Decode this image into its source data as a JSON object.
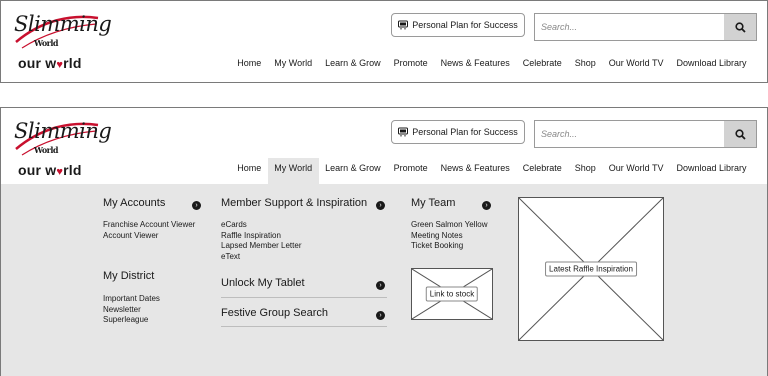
{
  "logo": {
    "script_line1": "Slimming",
    "script_line2": "World",
    "sub_prefix": "our w",
    "sub_suffix": "rld",
    "heart": "♥"
  },
  "header": {
    "plan_button_label": "Personal Plan for Success",
    "search_placeholder": "Search..."
  },
  "nav": [
    "Home",
    "My World",
    "Learn & Grow",
    "Promote",
    "News & Features",
    "Celebrate",
    "Shop",
    "Our World TV",
    "Download Library"
  ],
  "nav_active": "My World",
  "mega_menu": {
    "my_accounts": {
      "title": "My Accounts",
      "links": [
        "Franchise Account Viewer",
        "Account Viewer"
      ]
    },
    "my_district": {
      "title": "My District",
      "links": [
        "Important Dates",
        "Newsletter",
        "Superleague"
      ]
    },
    "member_support": {
      "title": "Member Support & Inspiration",
      "links": [
        "eCards",
        "Raffle Inspiration",
        "Lapsed Member Letter",
        "eText"
      ]
    },
    "unlock_tablet": {
      "title": "Unlock My Tablet"
    },
    "festive_search": {
      "title": "Festive Group Search"
    },
    "my_team": {
      "title": "My Team",
      "links": [
        "Green Salmon Yellow",
        "Meeting Notes",
        "Ticket Booking"
      ]
    },
    "link_to_stock": "Link to stock",
    "latest_raffle": "Latest Raffle Inspiration"
  },
  "colors": {
    "brand_red": "#c8102e",
    "menu_bg": "#e6e6e6",
    "search_btn": "#d2d2d2"
  }
}
